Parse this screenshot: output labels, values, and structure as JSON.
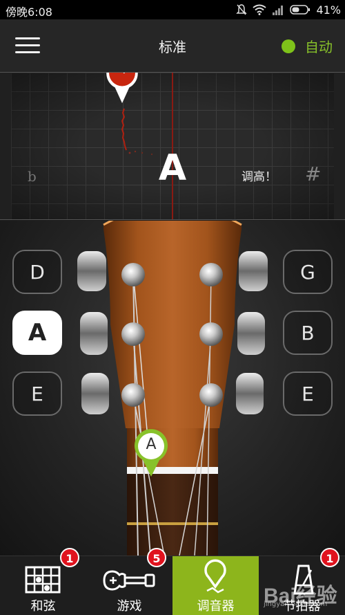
{
  "status_bar": {
    "time": "傍晚6:08",
    "battery_percent": "41%",
    "icons": [
      "mute-icon",
      "wifi-icon",
      "signal-icon",
      "battery-icon"
    ]
  },
  "header": {
    "title": "标准",
    "auto_label": "自动",
    "auto_color": "#7ec21a"
  },
  "tuner": {
    "cents_offset": "-7",
    "note": "A",
    "hint": "调高！",
    "flat_symbol": "b",
    "sharp_symbol": "#",
    "indicator_color": "#c8260f"
  },
  "strings": {
    "left": [
      "D",
      "A",
      "E"
    ],
    "right": [
      "G",
      "B",
      "E"
    ],
    "selected": "A",
    "current_note_pin": "A",
    "pin_color": "#88c22a"
  },
  "bottom_nav": {
    "items": [
      {
        "label": "和弦",
        "badge": "1",
        "icon": "chord-chart-icon"
      },
      {
        "label": "游戏",
        "badge": "5",
        "icon": "ukulele-icon"
      },
      {
        "label": "调音器",
        "badge": "",
        "icon": "tuner-pin-icon"
      },
      {
        "label": "节拍器",
        "badge": "1",
        "icon": "metronome-icon"
      }
    ],
    "active": "调音器",
    "active_color": "#8db51c"
  },
  "watermark": {
    "text": "Bai经验",
    "sub": "jingyan.baidu.com"
  }
}
